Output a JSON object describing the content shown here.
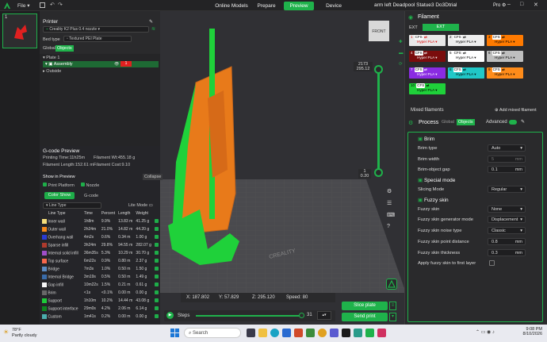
{
  "titlebar": {
    "menu": "File",
    "tabs": [
      "Online Models",
      "Prepare",
      "Preview",
      "Device"
    ],
    "project": "arm left Deadpool Statue3 Do3Dtrial",
    "user": "Pro"
  },
  "plate_thumb": {
    "number": "1"
  },
  "printer": {
    "title": "Printer",
    "name": "Creality K2 Plus 0.4 nozzle",
    "bed_label": "Bed type",
    "bed_value": "Textured PEI Plate",
    "global": "Global",
    "objects": "Objects",
    "plate": "Plate 1",
    "assembly": "Assembly",
    "assembly_badge": "1",
    "outside": "Outside"
  },
  "gcode": {
    "title": "G-code Preview",
    "printing_time": "Printing Time:11h25m",
    "filament_wt": "Filament Wt:455.18 g",
    "filament_length": "Filament Length:152.61 m",
    "filament_cost": "Filament Cost:9.10",
    "show_in_preview": "Show in Preview",
    "collapse": "Collapse",
    "print_platform": "Print Platform",
    "nozzle": "Nozzle",
    "color_show": "Color Show",
    "gcode_btn": "G-code",
    "dropdown": "Line Type",
    "lite_mode": "Lite Mode",
    "headers": [
      "Line Type",
      "Time",
      "Percent",
      "Length",
      "Weight"
    ],
    "rows": [
      {
        "name": "Inner wall",
        "time": "1h8m",
        "pct": "9.9%",
        "len": "13.83 m",
        "wt": "41.25 g",
        "color": "#ffe680"
      },
      {
        "name": "Outer wall",
        "time": "2h24m",
        "pct": "21.0%",
        "len": "14.82 m",
        "wt": "44.20 g",
        "color": "#ff8c1a"
      },
      {
        "name": "Overhang wall",
        "time": "4m2s",
        "pct": "0.6%",
        "len": "0.34 m",
        "wt": "1.00 g",
        "color": "#2a3cd9"
      },
      {
        "name": "Sparse infill",
        "time": "3h24m",
        "pct": "29.8%",
        "len": "94.55 m",
        "wt": "282.07 g",
        "color": "#b33b2e"
      },
      {
        "name": "Internal solid infill",
        "time": "36m35s",
        "pct": "5.3%",
        "len": "10.29 m",
        "wt": "30.70 g",
        "color": "#a550cf"
      },
      {
        "name": "Top surface",
        "time": "6m22s",
        "pct": "0.9%",
        "len": "0.80 m",
        "wt": "2.37 g",
        "color": "#ff6a4d"
      },
      {
        "name": "Bridge",
        "time": "7m3s",
        "pct": "1.0%",
        "len": "0.50 m",
        "wt": "1.50 g",
        "color": "#5e8fc9"
      },
      {
        "name": "Internal Bridge",
        "time": "3m19s",
        "pct": "0.5%",
        "len": "0.50 m",
        "wt": "1.49 g",
        "color": "#3a6fb0"
      },
      {
        "name": "Gap infill",
        "time": "10m22s",
        "pct": "1.5%",
        "len": "0.21 m",
        "wt": "0.61 g",
        "color": "#ffffff"
      },
      {
        "name": "Brim",
        "time": "<1s",
        "pct": "<0.1%",
        "len": "0.00 m",
        "wt": "0.00 g",
        "color": "#6b6b6b"
      },
      {
        "name": "Support",
        "time": "1h10m",
        "pct": "10.2%",
        "len": "14.44 m",
        "wt": "43.08 g",
        "color": "#1fd13a"
      },
      {
        "name": "Support interface",
        "time": "29m0s",
        "pct": "4.2%",
        "len": "2.06 m",
        "wt": "6.14 g",
        "color": "#0e8a20"
      },
      {
        "name": "Custom",
        "time": "1m41s",
        "pct": "0.2%",
        "len": "0.00 m",
        "wt": "0.00 g",
        "color": "#4db3b3"
      }
    ]
  },
  "viewport": {
    "view_label": "FRONT",
    "layer_top": "2173",
    "layer_top_h": "295.12",
    "layer_bottom": "1",
    "layer_bottom_h": "0.20",
    "coords": {
      "x": "X: 187.802",
      "y": "Y: 57.829",
      "z": "Z: 295.120",
      "speed": "Speed: 80"
    },
    "steps_label": "Steps",
    "steps_value": "31",
    "bed_brand": "CREALITY"
  },
  "actions": {
    "slice": "Slice plate",
    "send": "Send print"
  },
  "filament": {
    "title": "Filament",
    "ext": "EXT",
    "ext2": "EXT",
    "add_mixed": "Add mixed filament",
    "mixed": "Mixed filaments",
    "slots": [
      {
        "n": "1",
        "cfs": "CFS",
        "type": "Hyper PLA",
        "bg": "#e8e8e8",
        "fg": "#d00",
        "hl": "#e02020"
      },
      {
        "n": "2",
        "cfs": "CFS",
        "type": "Hyper PLA",
        "bg": "#eeeeee",
        "fg": "#000"
      },
      {
        "n": "3",
        "cfs": "CFS",
        "type": "Hyper PLA",
        "bg": "#ff7a00",
        "fg": "#000"
      },
      {
        "n": "4",
        "cfs": "CFS",
        "type": "Hyper PLA",
        "bg": "#7a0d0d",
        "fg": "#fff"
      },
      {
        "n": "5",
        "cfs": "CFS",
        "type": "Hyper PLA",
        "bg": "#ffffff",
        "fg": "#000"
      },
      {
        "n": "6",
        "cfs": "CFS",
        "type": "Hyper PLA",
        "bg": "#bfbfbf",
        "fg": "#000"
      },
      {
        "n": "7",
        "cfs": "CFS",
        "type": "Hyper PLA",
        "bg": "#8a2be2",
        "fg": "#fff"
      },
      {
        "n": "8",
        "cfs": "CFS",
        "type": "Hyper PLA",
        "bg": "#20c8c8",
        "fg": "#000"
      },
      {
        "n": "9",
        "cfs": "CFS",
        "type": "Hyper PLA",
        "bg": "#ff8c1a",
        "fg": "#000"
      },
      {
        "n": "10",
        "cfs": "CFS",
        "type": "Hyper PLA",
        "bg": "#1fd13a",
        "fg": "#000"
      }
    ]
  },
  "process": {
    "title": "Process",
    "global": "Global",
    "objects": "Objects",
    "advanced": "Advanced",
    "brim": "Brim",
    "brim_type": "Brim type",
    "brim_type_v": "Auto",
    "brim_width": "Brim width",
    "brim_width_v": "5",
    "brim_width_u": "mm",
    "brim_gap": "Brim-object gap",
    "brim_gap_v": "0.1",
    "brim_gap_u": "mm",
    "special": "Special mode",
    "slicing_mode": "Slicing Mode",
    "slicing_mode_v": "Regular",
    "fuzzy": "Fuzzy skin",
    "fz1": "Fuzzy skin",
    "fz1_v": "None",
    "fz2": "Fuzzy skin generator mode",
    "fz2_v": "Displacement",
    "fz3": "Fuzzy skin noise type",
    "fz3_v": "Classic",
    "fz4": "Fuzzy skin point distance",
    "fz4_v": "0.8",
    "fz4_u": "mm",
    "fz5": "Fuzzy skin thickness",
    "fz5_v": "0.3",
    "fz5_u": "mm",
    "fz6": "Apply fuzzy skin to first layer"
  },
  "taskbar": {
    "temp": "78°F",
    "weather": "Partly cloudy",
    "search": "Search",
    "time": "9:08 PM",
    "date": "8/10/2026"
  }
}
